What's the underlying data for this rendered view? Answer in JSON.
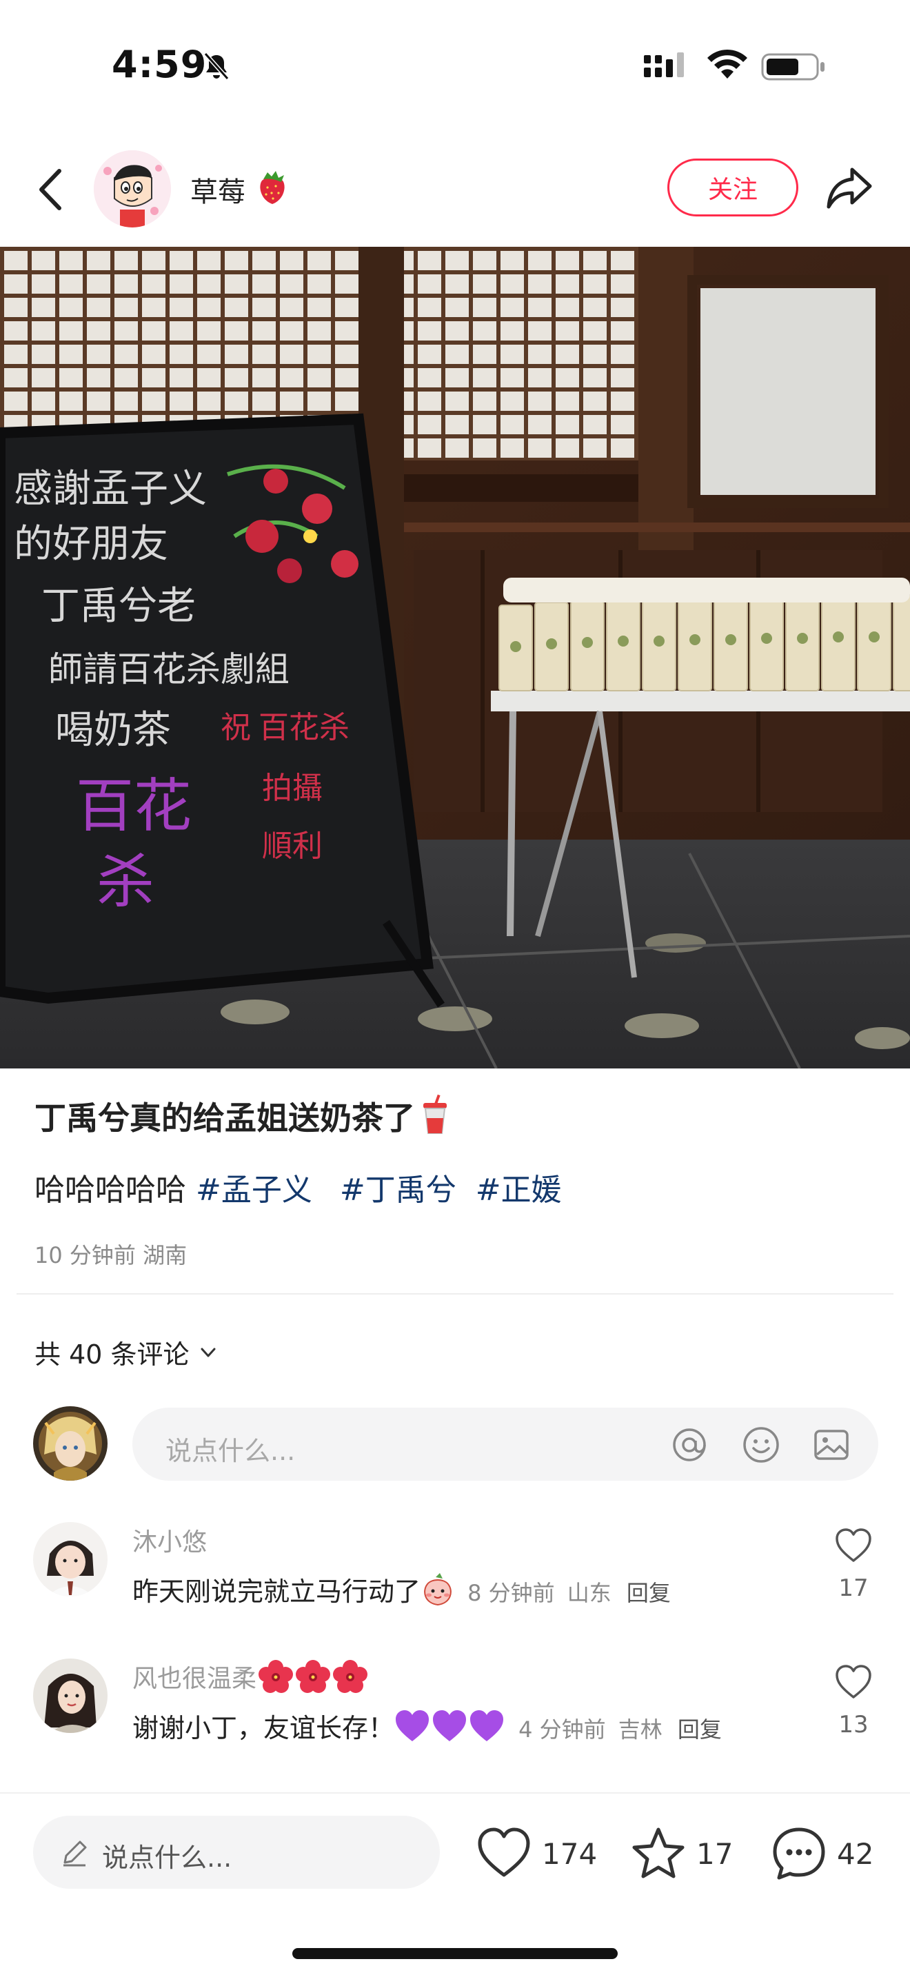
{
  "status_bar": {
    "time": "4:59"
  },
  "header": {
    "author_name": "草莓",
    "follow_label": "关注"
  },
  "post": {
    "title": "丁禹兮真的给孟姐送奶茶了",
    "body_text": "哈哈哈哈哈",
    "hashtags": [
      "#孟子义",
      "#丁禹兮",
      "#正媛"
    ],
    "time_ago": "10 分钟前",
    "location": "湖南",
    "photo_board_text": [
      "感謝孟子义",
      "的好朋友",
      "丁禹兮老",
      "師請百花杀劇組",
      "喝奶茶",
      "祝 百花杀",
      "拍攝",
      "順利",
      "百花",
      "杀"
    ]
  },
  "comments_section": {
    "count_label": "共 40 条评论",
    "input_placeholder": "说点什么...",
    "comments": [
      {
        "name": "沐小悠",
        "text": "昨天刚说完就立马行动了",
        "time_ago": "8 分钟前",
        "location": "山东",
        "reply_label": "回复",
        "likes": "17"
      },
      {
        "name": "风也很温柔",
        "text": "谢谢小丁，友谊长存！",
        "time_ago": "4 分钟前",
        "location": "吉林",
        "reply_label": "回复",
        "likes": "13"
      }
    ]
  },
  "bottom_bar": {
    "input_placeholder": "说点什么...",
    "like_count": "174",
    "collect_count": "17",
    "comment_count": "42"
  },
  "colors": {
    "accent": "#ff2a4a",
    "hashtag": "#13386c",
    "meta": "#8a8a8a"
  },
  "icons": [
    "back-icon",
    "share-icon",
    "at-icon",
    "emoji-icon",
    "image-icon",
    "heart-icon",
    "star-icon",
    "comment-bubble-icon",
    "pencil-icon"
  ]
}
